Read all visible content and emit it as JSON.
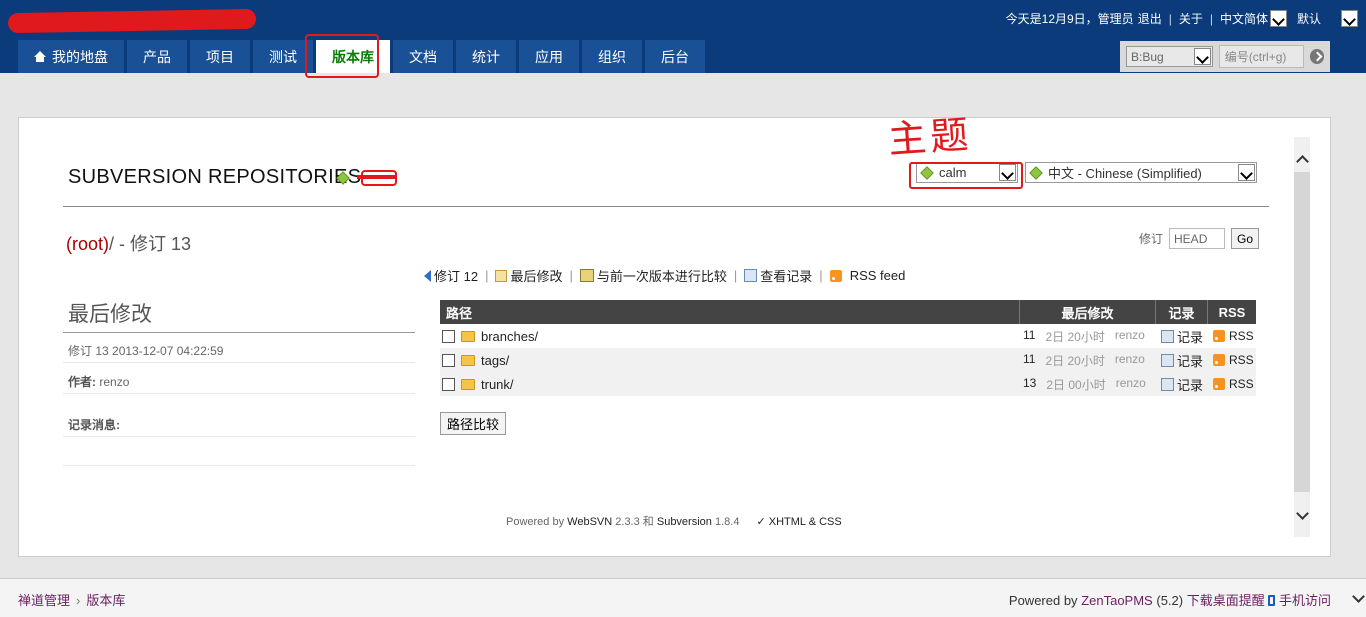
{
  "header": {
    "date_text": "今天是12月9日，管理员",
    "logout": "退出",
    "about": "关于",
    "language": "中文简体",
    "theme": "默认",
    "nav": [
      {
        "label": "我的地盘"
      },
      {
        "label": "产品"
      },
      {
        "label": "项目"
      },
      {
        "label": "测试"
      },
      {
        "label": "版本库"
      },
      {
        "label": "文档"
      },
      {
        "label": "统计"
      },
      {
        "label": "应用"
      },
      {
        "label": "组织"
      },
      {
        "label": "后台"
      }
    ],
    "search_type": "B:Bug",
    "search_placeholder": "编号(ctrl+g)"
  },
  "repo": {
    "title": "SUBVERSION REPOSITORIES",
    "annotation": "主题",
    "theme_value": "calm",
    "language_value": "中文 - Chinese (Simplified)",
    "path_root": "(root)",
    "path_rest": "/ - 修订 13",
    "revision_label": "修订",
    "revision_value": "HEAD",
    "go_label": "Go",
    "actions": [
      {
        "label": "修订 12"
      },
      {
        "label": "最后修改"
      },
      {
        "label": "与前一次版本进行比较"
      },
      {
        "label": "查看记录"
      },
      {
        "label": "RSS feed"
      }
    ],
    "sidebar": {
      "title": "最后修改",
      "rev_line": "修订 13 2013-12-07 04:22:59",
      "author_label": "作者:",
      "author_value": "renzo",
      "log_label": "记录消息:"
    },
    "table": {
      "headers": {
        "path": "路径",
        "last_mod": "最后修改",
        "log": "记录",
        "rss": "RSS"
      },
      "rows": [
        {
          "name": "branches/",
          "rev": "11",
          "ago": "2日 20小时",
          "author": "renzo",
          "log": "记录",
          "rss": "RSS"
        },
        {
          "name": "tags/",
          "rev": "11",
          "ago": "2日 20小时",
          "author": "renzo",
          "log": "记录",
          "rss": "RSS"
        },
        {
          "name": "trunk/",
          "rev": "13",
          "ago": "2日 00小时",
          "author": "renzo",
          "log": "记录",
          "rss": "RSS"
        }
      ]
    },
    "compare_button": "路径比较",
    "footer": {
      "powered": "Powered by",
      "websvn": "WebSVN",
      "websvn_ver": "2.3.3",
      "and": "和",
      "subversion": "Subversion",
      "svn_ver": "1.8.4",
      "valid": "✓ XHTML & CSS"
    }
  },
  "bottom": {
    "crumb_root": "禅道管理",
    "crumb_page": "版本库",
    "powered": "Powered by",
    "brand": "ZenTaoPMS",
    "version": "(5.2)",
    "download": "下载桌面提醒",
    "mobile": "手机访问"
  },
  "colors": {
    "header_bg": "#0b3b7a",
    "tab_bg": "#1a5196",
    "active_tab_text": "#0a7d0a",
    "annotation_red": "#e0191d",
    "table_header_bg": "#444444"
  }
}
